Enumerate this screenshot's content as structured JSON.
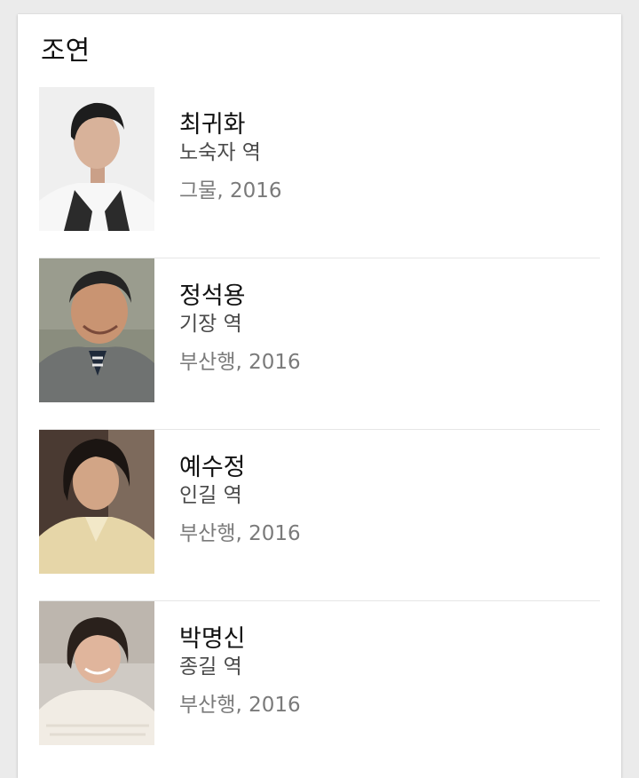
{
  "section": {
    "title": "조연"
  },
  "cast": [
    {
      "name": "최귀화",
      "role": "노숙자 역",
      "work": "그물, 2016"
    },
    {
      "name": "정석용",
      "role": "기장 역",
      "work": "부산행, 2016"
    },
    {
      "name": "예수정",
      "role": "인길 역",
      "work": "부산행, 2016"
    },
    {
      "name": "박명신",
      "role": "종길 역",
      "work": "부산행, 2016"
    }
  ]
}
